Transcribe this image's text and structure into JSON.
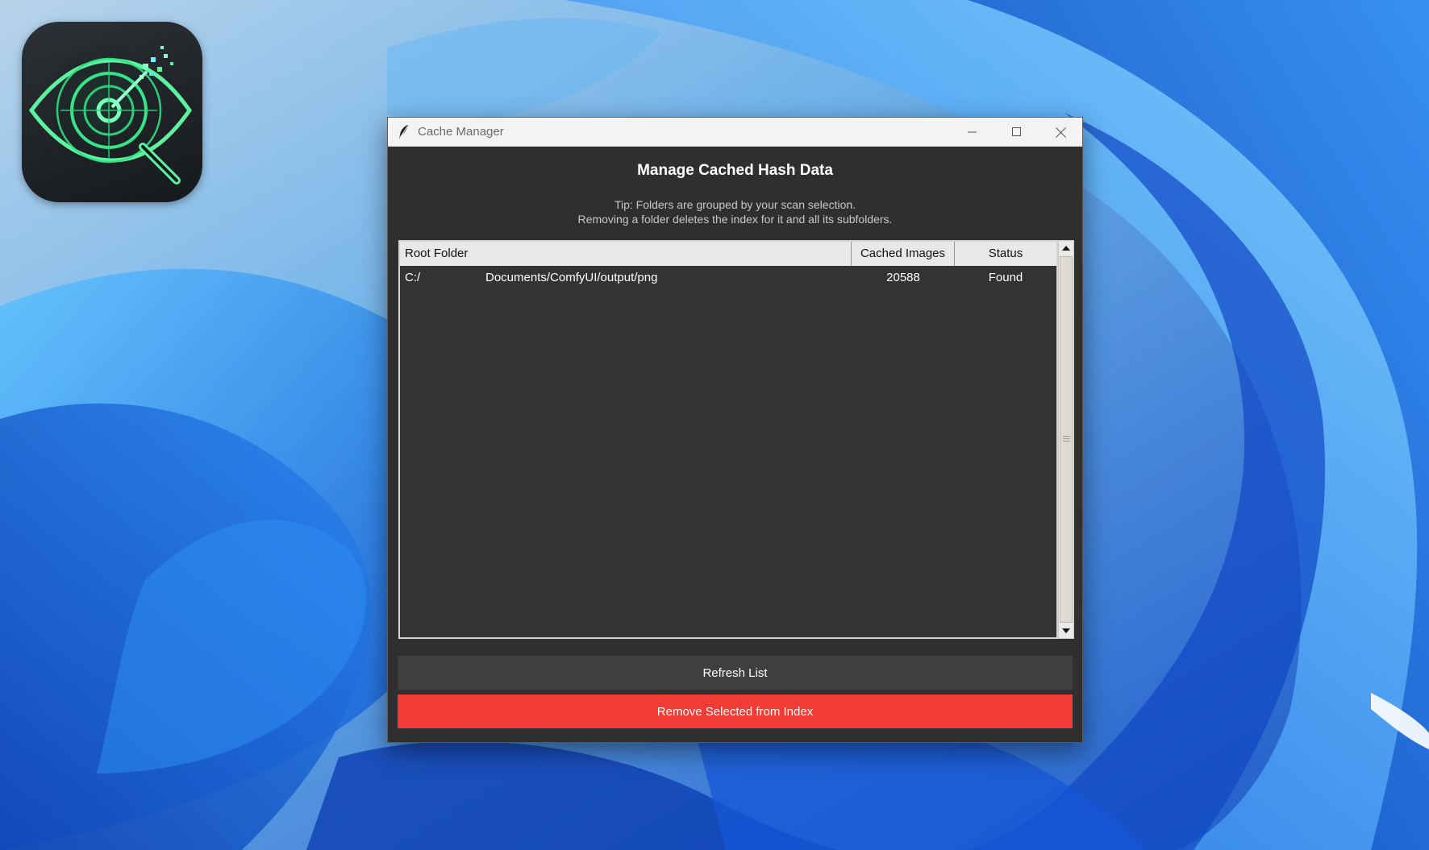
{
  "desktop": {
    "app_icon": "radar-eye-magnifier-icon"
  },
  "window": {
    "title": "Cache Manager",
    "title_icon": "feather-icon",
    "controls": {
      "minimize": "minimize-icon",
      "maximize": "maximize-icon",
      "close": "close-icon"
    }
  },
  "content": {
    "heading": "Manage Cached Hash Data",
    "tip_line1": "Tip: Folders are grouped by your scan selection.",
    "tip_line2": "Removing a folder deletes the index for it and all its subfolders."
  },
  "table": {
    "columns": {
      "root_folder": "Root Folder",
      "cached_images": "Cached Images",
      "status": "Status"
    },
    "rows": [
      {
        "root_prefix": "C:/",
        "root_path": "Documents/ComfyUI/output/png",
        "cached_images": "20588",
        "status": "Found"
      }
    ]
  },
  "buttons": {
    "refresh": "Refresh List",
    "remove": "Remove Selected from Index"
  },
  "colors": {
    "window_bg": "#2f2f2f",
    "remove_button": "#f03c34",
    "refresh_button": "#3f3f3f"
  }
}
